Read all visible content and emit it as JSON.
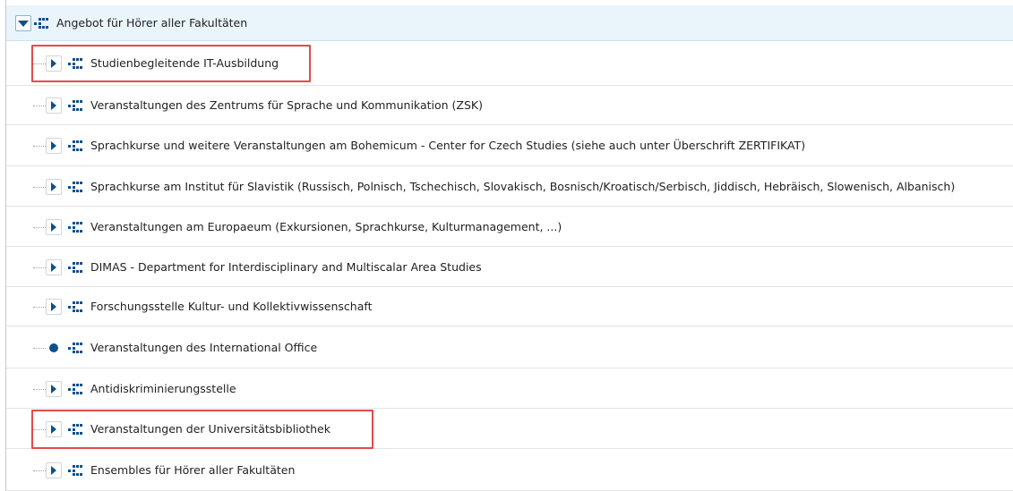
{
  "tree": {
    "root": {
      "label": "Angebot für Hörer aller Fakultäten",
      "expanded": true,
      "icon": "tree-structure-icon"
    },
    "children": [
      {
        "label": "Studienbegleitende IT-Ausbildung",
        "node": "expandable",
        "highlighted": true
      },
      {
        "label": "Veranstaltungen des Zentrums für Sprache und Kommunikation (ZSK)",
        "node": "expandable"
      },
      {
        "label": "Sprachkurse und weitere Veranstaltungen am Bohemicum - Center for Czech Studies (siehe auch unter Überschrift ZERTIFIKAT)",
        "node": "expandable"
      },
      {
        "label": "Sprachkurse am Institut für Slavistik (Russisch, Polnisch, Tschechisch, Slovakisch, Bosnisch/Kroatisch/Serbisch, Jiddisch, Hebräisch, Slowenisch, Albanisch)",
        "node": "expandable"
      },
      {
        "label": "Veranstaltungen am Europaeum (Exkursionen, Sprachkurse, Kulturmanagement, ...)",
        "node": "expandable"
      },
      {
        "label": "DIMAS - Department for Interdisciplinary and Multiscalar Area Studies",
        "node": "expandable"
      },
      {
        "label": "Forschungsstelle Kultur- und Kollektivwissenschaft",
        "node": "expandable"
      },
      {
        "label": "Veranstaltungen des International Office",
        "node": "leaf"
      },
      {
        "label": "Antidiskriminierungsstelle",
        "node": "expandable"
      },
      {
        "label": "Veranstaltungen der Universitätsbibliothek",
        "node": "expandable",
        "highlighted": true
      },
      {
        "label": "Ensembles für Hörer aller Fakultäten",
        "node": "expandable"
      }
    ]
  },
  "colors": {
    "accent": "#0e4f8c",
    "highlight": "#e24b4b",
    "root_row_bg": "#eaf4fb"
  }
}
